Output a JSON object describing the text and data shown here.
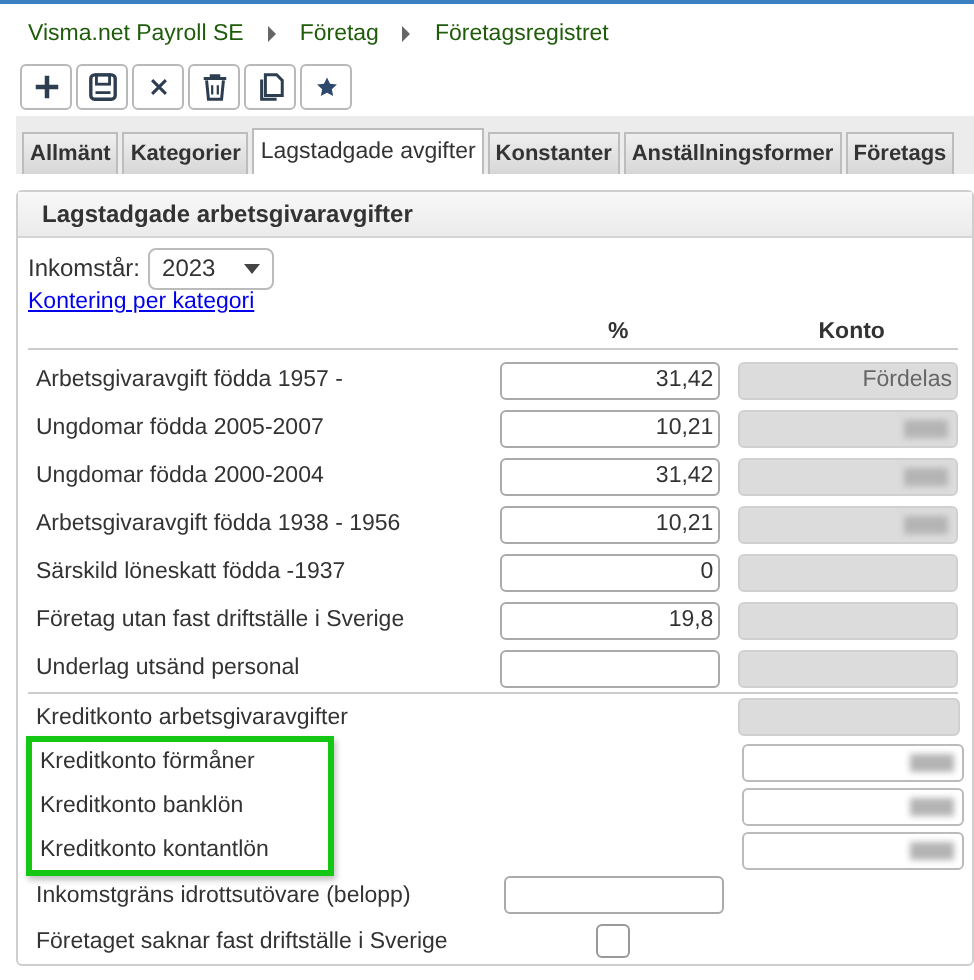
{
  "breadcrumb": [
    "Visma.net Payroll SE",
    "Företag",
    "Företagsregistret"
  ],
  "toolbar": [
    {
      "kind": "add"
    },
    {
      "kind": "save"
    },
    {
      "kind": "cancel"
    },
    {
      "kind": "delete"
    },
    {
      "kind": "copy"
    },
    {
      "kind": "favorite"
    }
  ],
  "tabs": [
    {
      "label": "Allmänt",
      "selected": false
    },
    {
      "label": "Kategorier",
      "selected": false
    },
    {
      "label": "Lagstadgade avgifter",
      "selected": true
    },
    {
      "label": "Konstanter",
      "selected": false
    },
    {
      "label": "Anställningsformer",
      "selected": false
    },
    {
      "label": "Företags",
      "selected": false
    }
  ],
  "panel": {
    "title": "Lagstadgade arbetsgivaravgifter",
    "year_label": "Inkomstår:",
    "year": "2023",
    "link": "Kontering per kategori",
    "columns": [
      "%",
      "Konto"
    ]
  },
  "rows": [
    {
      "kind": "rate",
      "label": "Arbetsgivaravgift födda 1957 -",
      "percent": "31,42",
      "konto": {
        "value": "Fördelas",
        "redacted": false,
        "disabled": true
      }
    },
    {
      "kind": "rate",
      "label": "Ungdomar födda 2005-2007",
      "percent": "10,21",
      "konto": {
        "redacted": true,
        "disabled": true
      }
    },
    {
      "kind": "rate",
      "label": "Ungdomar födda 2000-2004",
      "percent": "31,42",
      "konto": {
        "redacted": true,
        "disabled": true
      }
    },
    {
      "kind": "rate",
      "label": "Arbetsgivaravgift födda 1938 - 1956",
      "percent": "10,21",
      "konto": {
        "redacted": true,
        "disabled": true
      }
    },
    {
      "kind": "rate",
      "label": "Särskild löneskatt födda -1937",
      "percent": "0",
      "konto": {
        "redacted": false,
        "disabled": true
      }
    },
    {
      "kind": "rate",
      "label": "Företag utan fast driftställe i Sverige",
      "percent": "19,8",
      "konto": {
        "redacted": false,
        "disabled": true
      }
    },
    {
      "kind": "rate",
      "label": "Underlag utsänd personal",
      "percent": "",
      "konto": {
        "redacted": false,
        "disabled": true
      }
    },
    {
      "kind": "credit",
      "label": "Kreditkonto arbetsgivaravgifter",
      "highlighted": false,
      "konto": {
        "redacted": false,
        "disabled": true
      }
    },
    {
      "kind": "credit",
      "label": "Kreditkonto förmåner",
      "highlighted": true,
      "konto": {
        "redacted": true,
        "disabled": false
      }
    },
    {
      "kind": "credit",
      "label": "Kreditkonto banklön",
      "highlighted": true,
      "konto": {
        "redacted": true,
        "disabled": false
      }
    },
    {
      "kind": "credit",
      "label": "Kreditkonto kontantlön",
      "highlighted": true,
      "konto": {
        "redacted": true,
        "disabled": false
      }
    },
    {
      "kind": "amount",
      "label": "Inkomstgräns idrottsutövare (belopp)"
    },
    {
      "kind": "checkbox",
      "label": "Företaget saknar fast driftställe i Sverige",
      "checked": false
    }
  ]
}
